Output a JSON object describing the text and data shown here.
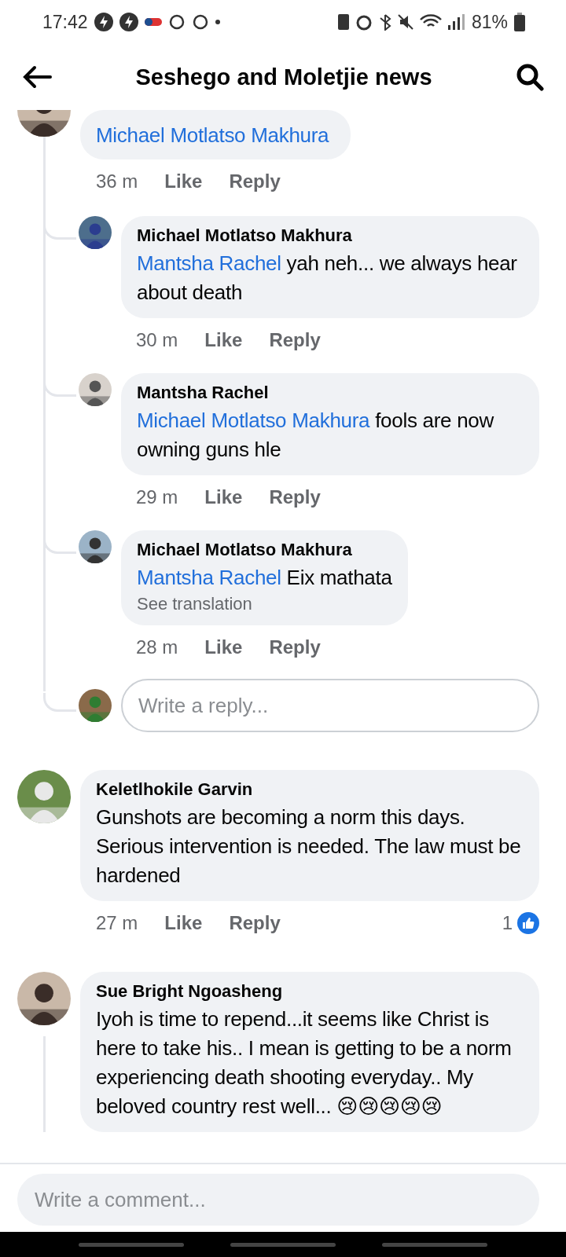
{
  "status_bar": {
    "time": "17:42",
    "battery": "81%"
  },
  "header": {
    "title": "Seshego and Moletjie news"
  },
  "comments": [
    {
      "mention": "Michael Motlatso Makhura",
      "time": "36 m",
      "like": "Like",
      "reply": "Reply",
      "cut_top": true,
      "replies": [
        {
          "author": "Michael Motlatso Makhura",
          "mention": "Mantsha Rachel",
          "text": " yah neh... we always hear about death",
          "time": "30 m",
          "like": "Like",
          "reply": "Reply"
        },
        {
          "author": "Mantsha Rachel",
          "mention": "Michael Motlatso Makhura",
          "text": " fools are now owning guns hle",
          "time": "29 m",
          "like": "Like",
          "reply": "Reply"
        },
        {
          "author": "Michael Motlatso Makhura",
          "mention": "Mantsha Rachel",
          "text": " Eix mathata",
          "translation": "See translation",
          "time": "28 m",
          "like": "Like",
          "reply": "Reply"
        }
      ],
      "reply_placeholder": "Write a reply..."
    },
    {
      "author": "Keletlhokile Garvin",
      "text": "Gunshots are becoming a norm this days.  Serious intervention is needed. The law must be hardened",
      "time": "27 m",
      "like": "Like",
      "reply": "Reply",
      "reactions": "1"
    },
    {
      "author": "Sue Bright Ngoasheng",
      "text": "Iyoh is time to repend...it seems like Christ is here to take his.. I mean is getting to be a norm experiencing death shooting everyday.. My beloved country rest well... 😢😢😢😢😢",
      "thread_continues": true
    }
  ],
  "composer": {
    "placeholder": "Write a comment..."
  }
}
